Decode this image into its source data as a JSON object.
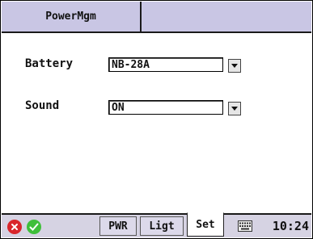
{
  "title_tab": "PowerMgm",
  "fields": {
    "battery": {
      "label": "Battery",
      "value": "NB-28A"
    },
    "sound": {
      "label": "Sound",
      "value": "ON"
    }
  },
  "taskbar": {
    "tabs": [
      "PWR",
      "Ligt",
      "Set"
    ],
    "active_tab": "Set",
    "clock": "10:24",
    "icons": [
      "close-icon",
      "ok-icon",
      "keyboard-icon",
      "chevron-down-icon"
    ],
    "colors": {
      "close": "#d9262b",
      "ok": "#3fbf3a",
      "titlebar": "#c9c6e4"
    }
  }
}
